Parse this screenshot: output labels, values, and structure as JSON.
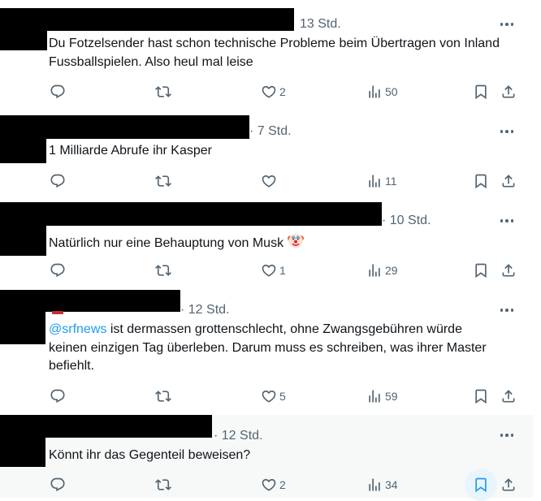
{
  "tweets": [
    {
      "time": "13 Std.",
      "text": "Du Fotzelsender hast schon technische Probleme beim Übertragen von Inland Fussballspielen. Also heul mal leise",
      "counts": {
        "replies": "",
        "retweets": "",
        "likes": "2",
        "views": "50"
      }
    },
    {
      "time": "· 7 Std.",
      "text": "1 Milliarde Abrufe ihr Kasper",
      "counts": {
        "replies": "",
        "retweets": "",
        "likes": "",
        "views": "11"
      }
    },
    {
      "time": "· 10 Std.",
      "text": "Natürlich nur eine Behauptung von Musk",
      "emoji": "clown-face-emoji",
      "counts": {
        "replies": "",
        "retweets": "",
        "likes": "1",
        "views": "29"
      }
    },
    {
      "time": "· 12 Std.",
      "mention": "@srfnews",
      "text": " ist dermassen grottenschlecht, ohne Zwangsgebühren würde keinen einzigen Tag überleben. Darum muss es schreiben, was ihrer Master befiehlt.",
      "counts": {
        "replies": "",
        "retweets": "",
        "likes": "5",
        "views": "59"
      }
    },
    {
      "time": "· 12 Std.",
      "text": "Könnt ihr das Gegenteil beweisen?",
      "counts": {
        "replies": "",
        "retweets": "",
        "likes": "2",
        "views": "34"
      },
      "bookmark_hovered": true
    }
  ],
  "colors": {
    "text": "#0f1419",
    "muted": "#536471",
    "link": "#1d9bf0",
    "divider": "#eff3f4",
    "hover_bg": "#f7f9f9",
    "redaction": "#000000"
  },
  "icons": [
    "reply-icon",
    "retweet-icon",
    "like-icon",
    "views-icon",
    "bookmark-icon",
    "share-icon",
    "more-icon"
  ]
}
